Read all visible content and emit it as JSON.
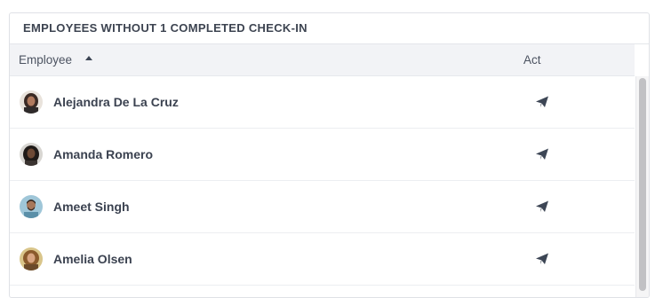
{
  "widget": {
    "title": "EMPLOYEES WITHOUT 1 COMPLETED CHECK-IN",
    "columns": {
      "employee": "Employee",
      "act": "Act"
    },
    "sort": {
      "column": "Employee",
      "direction": "ascending"
    },
    "rows": [
      {
        "name": "Alejandra De La Cruz",
        "avatar": "avatar-alejandra",
        "action_icon": "send-icon"
      },
      {
        "name": "Amanda Romero",
        "avatar": "avatar-amanda",
        "action_icon": "send-icon"
      },
      {
        "name": "Ameet Singh",
        "avatar": "avatar-ameet",
        "action_icon": "send-icon"
      },
      {
        "name": "Amelia Olsen",
        "avatar": "avatar-amelia",
        "action_icon": "send-icon"
      }
    ]
  },
  "colors": {
    "header_bg": "#f2f3f6",
    "text": "#3b4250",
    "icon": "#3d4655",
    "border": "#dfe1e6"
  }
}
